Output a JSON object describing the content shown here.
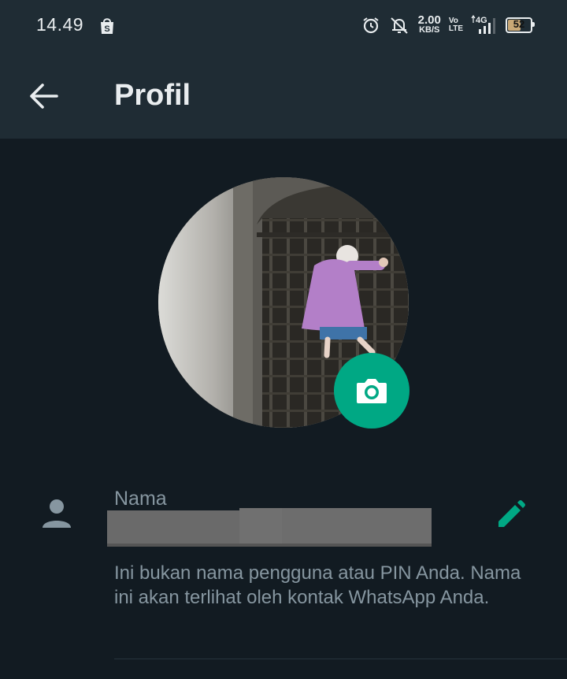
{
  "status_bar": {
    "time": "14.49",
    "net_speed_value": "2.00",
    "net_speed_unit": "KB/S",
    "volte_top": "Vo",
    "volte_bottom": "LTE",
    "network": "4G",
    "battery": "52",
    "icons": [
      "shopee-bag-icon",
      "alarm-icon",
      "silent-bell-icon",
      "signal-icon"
    ]
  },
  "appbar": {
    "back_icon": "arrow-left-icon",
    "title": "Profil"
  },
  "profile": {
    "camera_icon": "camera-icon",
    "name_label": "Nama",
    "name_value": "",
    "edit_icon": "pencil-icon",
    "hint": "Ini bukan nama pengguna atau PIN Anda. Nama ini akan terlihat oleh kontak WhatsApp Anda."
  },
  "colors": {
    "background": "#121b22",
    "bar": "#1f2c34",
    "accent": "#00a884",
    "secondary_text": "#8696a0"
  }
}
